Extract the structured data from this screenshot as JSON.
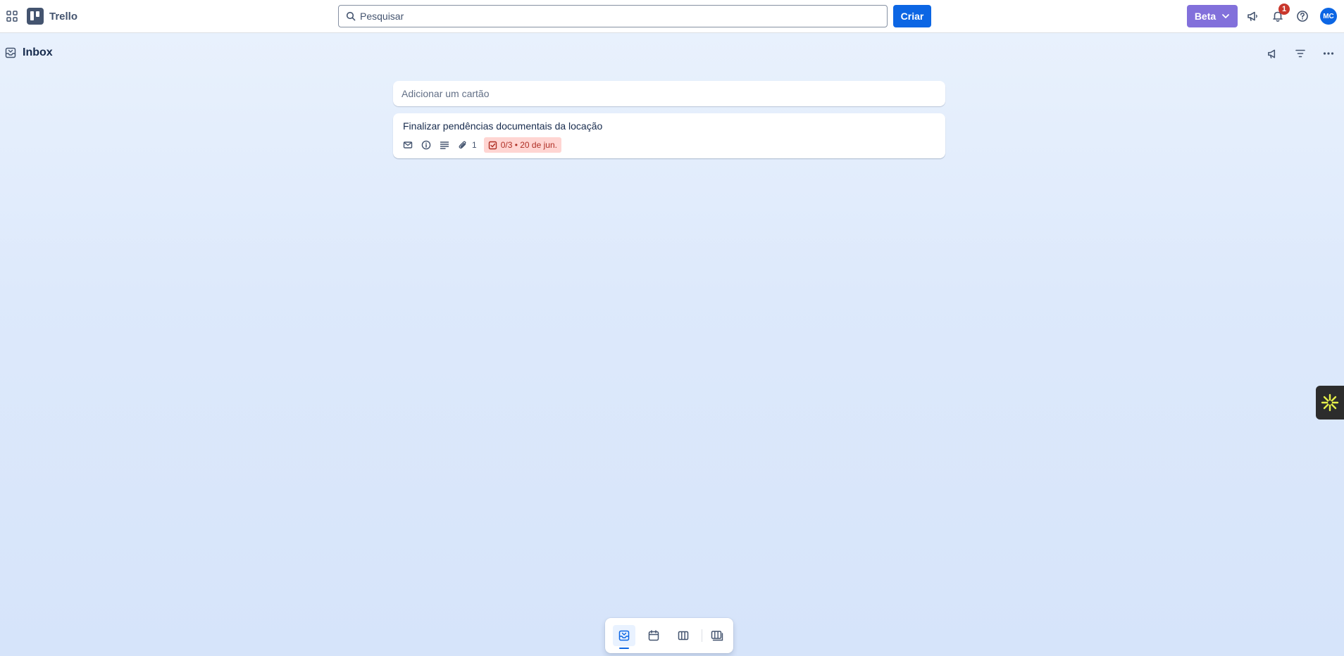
{
  "header": {
    "app_name": "Trello",
    "search_placeholder": "Pesquisar",
    "create_label": "Criar",
    "beta_label": "Beta",
    "notification_count": "1",
    "avatar_initials": "MC"
  },
  "inbox": {
    "title": "Inbox"
  },
  "add_card": {
    "placeholder": "Adicionar um cartão"
  },
  "cards": [
    {
      "title": "Finalizar pendências documentais da locação",
      "attachment_count": "1",
      "checklist": "0/3",
      "due_date": "20 de jun.",
      "due_text": "0/3 • 20 de jun."
    }
  ],
  "colors": {
    "brand_blue": "#0c66e4",
    "beta_purple": "#8270db",
    "overdue_bg": "#ffd5d2",
    "overdue_text": "#ae2e24"
  },
  "view_switcher": {
    "items": [
      "inbox-icon",
      "calendar-icon",
      "board-icon",
      "boards-switch-icon"
    ],
    "active": "inbox-icon"
  }
}
